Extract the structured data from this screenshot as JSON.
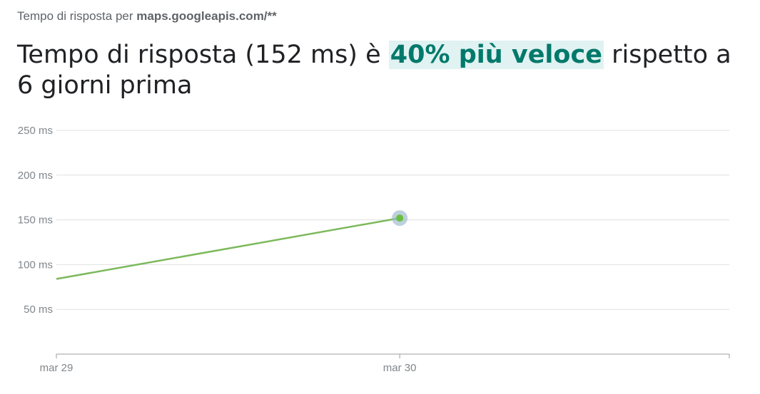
{
  "header": {
    "subtitle_prefix": "Tempo di risposta per",
    "subtitle_host": "maps.googleapis.com/**",
    "headline_pre": "Tempo di risposta (152 ms) è",
    "headline_highlight": "40% più veloce",
    "headline_post": "rispetto a 6 giorni prima"
  },
  "colors": {
    "line": "#7cb95c",
    "point": "#6abf3f",
    "point_halo": "#9ab7c9",
    "highlight_text": "#00796b",
    "highlight_bg": "#e0f2f1",
    "grid": "#e0e0e0",
    "axis": "#9e9e9e"
  },
  "chart_data": {
    "type": "line",
    "x": [
      "mar 29",
      "mar 30"
    ],
    "series": [
      {
        "values": [
          84,
          152
        ]
      }
    ],
    "x_ticks": [
      "mar 29",
      "mar 30"
    ],
    "x_extent": [
      0,
      1.96
    ],
    "y_ticks": [
      {
        "value": 50,
        "label": "50 ms"
      },
      {
        "value": 100,
        "label": "100 ms"
      },
      {
        "value": 150,
        "label": "150 ms"
      },
      {
        "value": 200,
        "label": "200 ms"
      },
      {
        "value": 250,
        "label": "250 ms"
      }
    ],
    "ylim": [
      0,
      250
    ],
    "grid": true,
    "highlight_index": 1
  }
}
